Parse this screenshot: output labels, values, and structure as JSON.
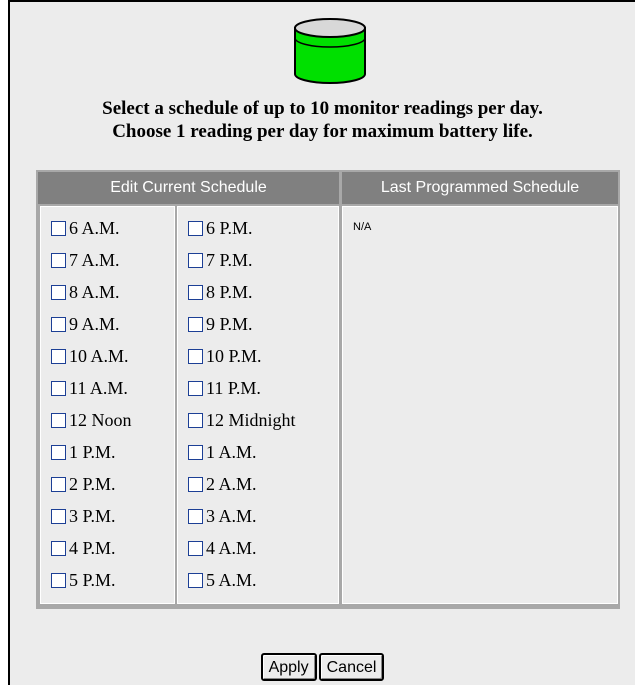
{
  "header": {
    "icon": "battery-tank-icon",
    "line1": "Select a schedule of up to 10 monitor readings per day.",
    "line2": "Choose 1 reading per day for maximum battery life."
  },
  "schedule": {
    "edit_header": "Edit Current Schedule",
    "last_header": "Last Programmed Schedule",
    "am_column": [
      {
        "label": "6 A.M.",
        "checked": false
      },
      {
        "label": "7 A.M.",
        "checked": false
      },
      {
        "label": "8 A.M.",
        "checked": false
      },
      {
        "label": "9 A.M.",
        "checked": false
      },
      {
        "label": "10 A.M.",
        "checked": false
      },
      {
        "label": "11 A.M.",
        "checked": false
      },
      {
        "label": "12 Noon",
        "checked": false
      },
      {
        "label": "1 P.M.",
        "checked": false
      },
      {
        "label": "2 P.M.",
        "checked": false
      },
      {
        "label": "3 P.M.",
        "checked": false
      },
      {
        "label": "4 P.M.",
        "checked": false
      },
      {
        "label": "5 P.M.",
        "checked": false
      }
    ],
    "pm_column": [
      {
        "label": "6 P.M.",
        "checked": false
      },
      {
        "label": "7 P.M.",
        "checked": false
      },
      {
        "label": "8 P.M.",
        "checked": false
      },
      {
        "label": "9 P.M.",
        "checked": false
      },
      {
        "label": "10 P.M.",
        "checked": false
      },
      {
        "label": "11 P.M.",
        "checked": false
      },
      {
        "label": "12 Midnight",
        "checked": false
      },
      {
        "label": "1 A.M.",
        "checked": false
      },
      {
        "label": "2 A.M.",
        "checked": false
      },
      {
        "label": "3 A.M.",
        "checked": false
      },
      {
        "label": "4 A.M.",
        "checked": false
      },
      {
        "label": "5 A.M.",
        "checked": false
      }
    ],
    "last_programmed": "N/A"
  },
  "buttons": {
    "apply": "Apply",
    "cancel": "Cancel"
  },
  "colors": {
    "tank_fill": "#00e000",
    "header_bg": "#808080",
    "checkbox_border": "#1c3f95"
  }
}
